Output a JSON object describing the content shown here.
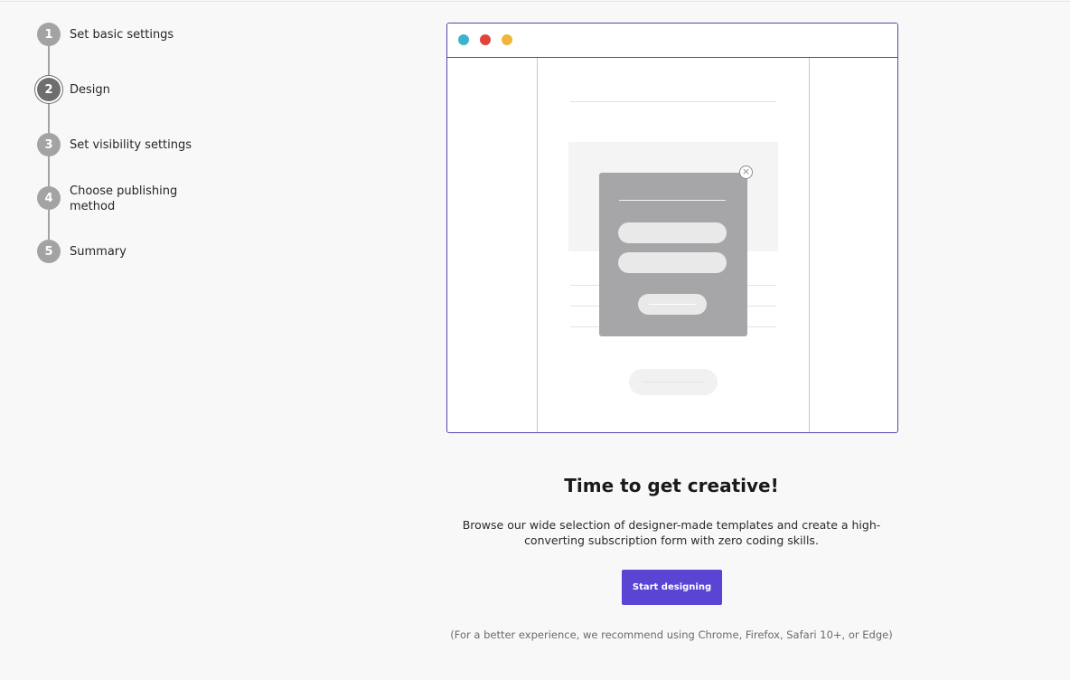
{
  "stepper": {
    "steps": [
      {
        "number": "1",
        "label": "Set basic settings"
      },
      {
        "number": "2",
        "label": "Design",
        "active": true
      },
      {
        "number": "3",
        "label": "Set visibility settings"
      },
      {
        "number": "4",
        "label": "Choose publishing method"
      },
      {
        "number": "5",
        "label": "Summary"
      }
    ]
  },
  "illustration": {
    "dot_colors": [
      "#3bb4c9",
      "#e0443c",
      "#f0b43a"
    ],
    "close_icon": "×"
  },
  "main": {
    "headline": "Time to get creative!",
    "description": "Browse our wide selection of designer-made templates and create a high-converting subscription form with zero coding skills.",
    "button_label": "Start designing",
    "note": "(For a better experience, we recommend using Chrome, Firefox, Safari 10+, or Edge)"
  },
  "colors": {
    "accent": "#5a44d4",
    "frame_border": "#5b46a8",
    "step_inactive": "#a3a3a3",
    "step_active": "#6e6e6e"
  }
}
